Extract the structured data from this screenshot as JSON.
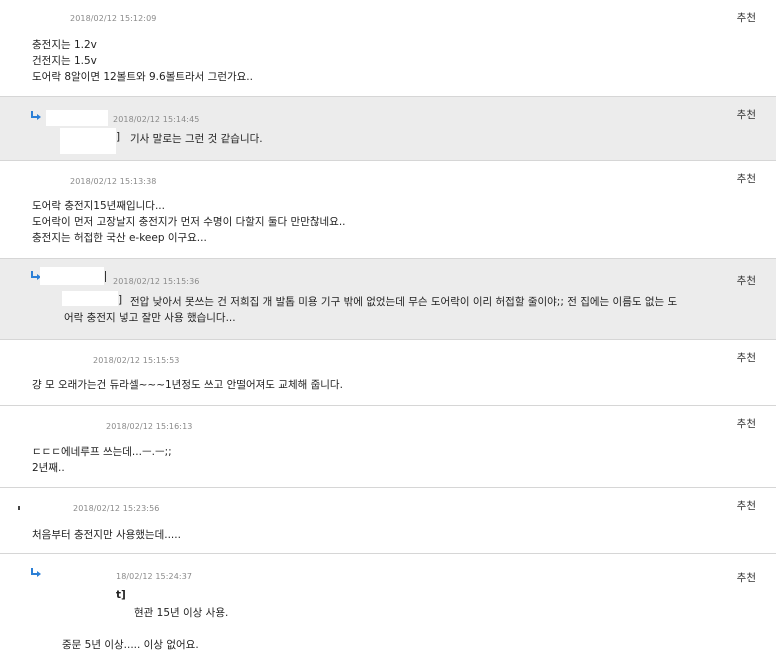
{
  "recommend_label": "추천",
  "comments": [
    {
      "date": "2018/02/12 15:12:09",
      "body": "충전지는 1.2v\n건전지는 1.5v\n도어락 8알이면 12볼트와 9.6볼트라서 그런가요.."
    },
    {
      "date": "2018/02/12 15:14:45",
      "tag": "]",
      "body": "기사 말로는 그런 것 같습니다."
    },
    {
      "date": "2018/02/12 15:13:38",
      "body": "도어락 충전지15년째입니다...\n도어락이 먼저 고장날지 충전지가 먼저 수명이 다할지 둘다 만만찮네요..\n충전지는 허접한 국산 e-keep 이구요..."
    },
    {
      "date": "2018/02/12 15:15:36",
      "tag": "]",
      "body": "전압 낮아서 못쓰는 건 저희집 개 발톱 미용 기구 밖에 없었는데 무슨 도어락이 이리 허접할 줄이야;; 전 집에는 이름도 없는 도\n어락 충전지 넣고 잘만 사용 했습니다..."
    },
    {
      "date": "2018/02/12 15:15:53",
      "body": "걍 모 오래가는건 듀라셀~~~1년정도 쓰고 안떨어져도 교체해 줍니다."
    },
    {
      "date": "2018/02/12 15:16:13",
      "body": "ㄷㄷㄷ에네루프 쓰는데...ㅡ.ㅡ;;\n2년째.."
    },
    {
      "date": "2018/02/12 15:23:56",
      "body": "처음부터 충전지만 사용했는데....."
    },
    {
      "date": "18/02/12 15:24:37",
      "tag": "t]",
      "body": "현관 15년 이상 사용.\n\n중문 5년 이상..... 이상 없어요."
    }
  ]
}
